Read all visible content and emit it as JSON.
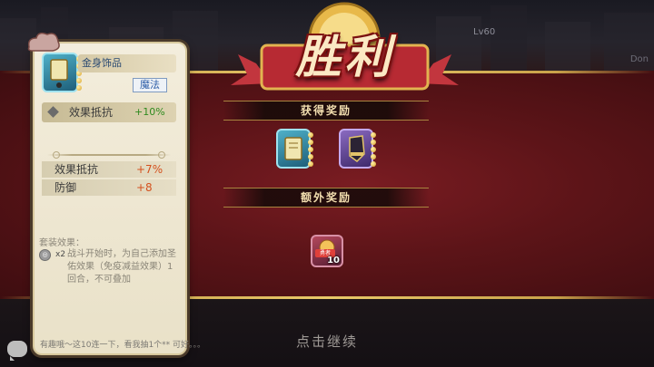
{
  "background": {
    "level_text": "Lv60",
    "corner_text": "Don"
  },
  "victory": {
    "title": "胜利"
  },
  "rewards": {
    "header": "获得奖励",
    "items": [
      {
        "name": "book-accessory",
        "rarity_color": "#4fb0c8"
      },
      {
        "name": "glove-item",
        "rarity_color": "#8a6ac0"
      }
    ]
  },
  "extra_rewards": {
    "header": "额外奖励",
    "item": {
      "tag": "勇者",
      "count": "10"
    }
  },
  "continue_label": "点击继续",
  "tooltip": {
    "item_name": "金身饰品",
    "item_type": "魔法",
    "main_stat": {
      "label": "效果抵抗",
      "value": "+10%"
    },
    "sub_stats": [
      {
        "label": "效果抵抗",
        "value": "+7%"
      },
      {
        "label": "防御",
        "value": "+8"
      }
    ],
    "set_title": "套装效果：",
    "set_count": "x2",
    "set_desc": "战斗开始时，为自己添加圣佑效果（免疫减益效果）1回合，不可叠加"
  },
  "chat": {
    "text": "有趣哦～这10连一下，看我抽1个** 可好。。。"
  },
  "colors": {
    "accent_gold": "#e8c96a",
    "band_red": "#5c1418",
    "stat_green": "#2f8a1f",
    "stat_orange": "#d4511e"
  }
}
